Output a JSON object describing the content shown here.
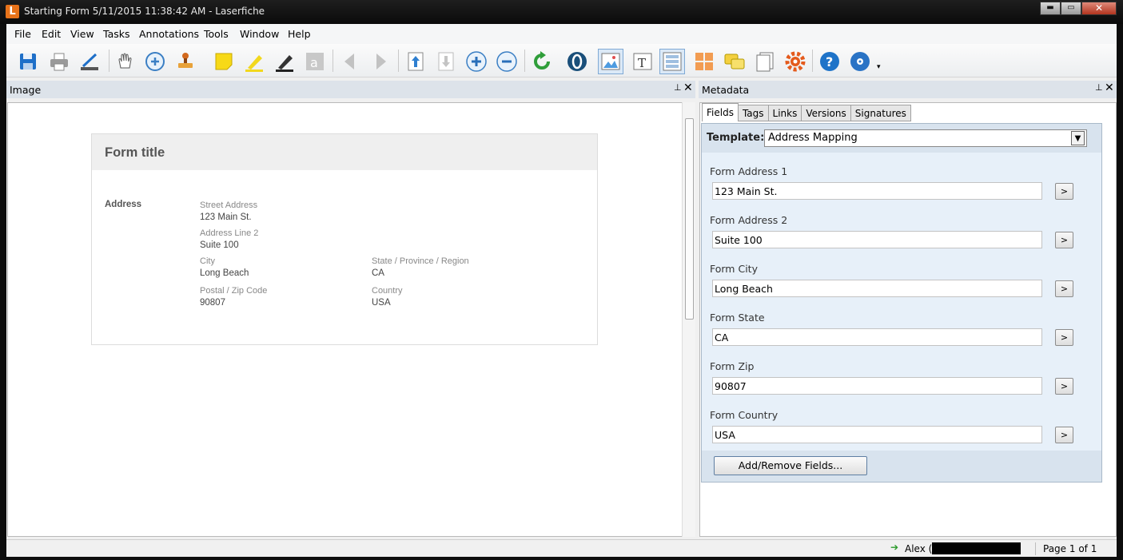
{
  "window": {
    "app_icon": "L",
    "title": "Starting Form 5/11/2015 11:38:42 AM - Laserfiche",
    "minimize": "▬",
    "maximize": "▭",
    "close": "✕"
  },
  "menu": [
    "File",
    "Edit",
    "View",
    "Tasks",
    "Annotations",
    "Tools",
    "Window",
    "Help"
  ],
  "toolbar": {
    "icons": [
      "save-icon",
      "print-icon",
      "scan-icon",
      "pan-hand-icon",
      "zoom-rect-icon",
      "stamp-icon",
      "sticky-note-icon",
      "highlighter-icon",
      "marker-icon",
      "text-annotation-icon",
      "previous-arrow-icon",
      "next-arrow-icon",
      "upload-icon",
      "download-icon",
      "zoom-in-icon",
      "zoom-out-icon",
      "refresh-icon",
      "ocr-icon",
      "image-view-icon",
      "text-view-icon",
      "metadata-view-icon",
      "thumbnails-icon",
      "annotations-list-icon",
      "document-pages-icon",
      "settings-gear-icon",
      "help-icon",
      "disc-icon"
    ],
    "overflow": "▾"
  },
  "image_panel": {
    "title": "Image",
    "pin": "⊥",
    "close": "✕"
  },
  "form": {
    "title": "Form title",
    "section": "Address",
    "street_label": "Street Address",
    "street_value": "123 Main St.",
    "line2_label": "Address Line 2",
    "line2_value": "Suite 100",
    "city_label": "City",
    "city_value": "Long Beach",
    "state_label": "State / Province / Region",
    "state_value": "CA",
    "zip_label": "Postal / Zip Code",
    "zip_value": "90807",
    "country_label": "Country",
    "country_value": "USA"
  },
  "metadata_panel": {
    "title": "Metadata",
    "pin": "⊥",
    "close": "✕",
    "tabs": [
      "Fields",
      "Tags",
      "Links",
      "Versions",
      "Signatures"
    ],
    "template_label": "Template:",
    "template_value": "Address Mapping",
    "fields": [
      {
        "label": "Form Address 1",
        "value": "123 Main St.",
        "button": ">"
      },
      {
        "label": "Form Address 2",
        "value": "Suite 100",
        "button": ">"
      },
      {
        "label": "Form City",
        "value": "Long Beach",
        "button": ">"
      },
      {
        "label": "Form State",
        "value": "CA",
        "button": ">"
      },
      {
        "label": "Form Zip",
        "value": "90807",
        "button": ">"
      },
      {
        "label": "Form Country",
        "value": "USA",
        "button": ">"
      }
    ],
    "add_remove_button": "Add/Remove Fields..."
  },
  "status": {
    "user": "Alex (",
    "page": "Page 1 of 1"
  },
  "colors": {
    "accent_orange": "#e8731a",
    "panel_blue": "#e7f0f9",
    "header_blue": "#dde3ea"
  }
}
